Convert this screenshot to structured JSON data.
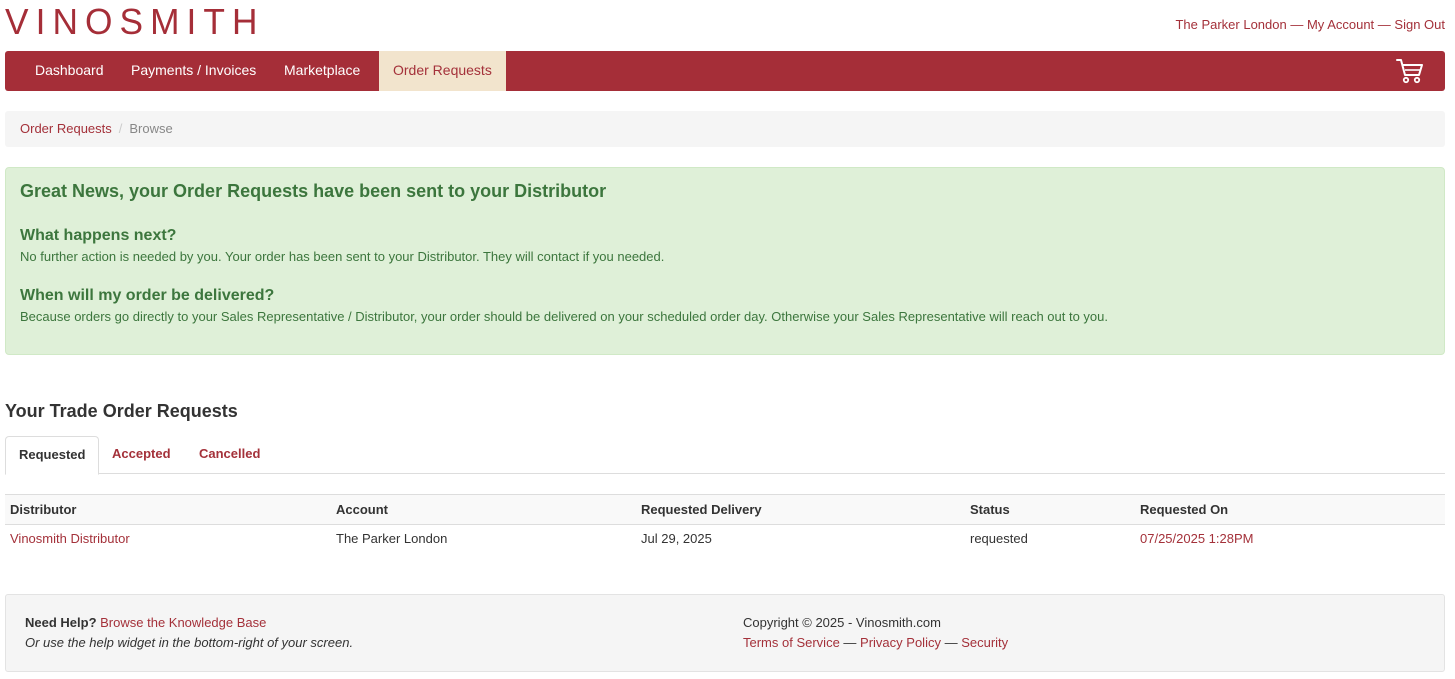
{
  "brand": {
    "logo": "VINOSMITH"
  },
  "top_links": {
    "account_name": "The Parker London",
    "sep1": " — ",
    "my_account": "My Account",
    "sep2": " — ",
    "sign_out": "Sign Out"
  },
  "nav": {
    "items": [
      {
        "label": "Dashboard"
      },
      {
        "label": "Payments / Invoices"
      },
      {
        "label": "Marketplace"
      },
      {
        "label": "Order Requests"
      }
    ],
    "cart_icon": "shopping-cart"
  },
  "breadcrumb": {
    "parent": "Order Requests",
    "separator": "/",
    "current": "Browse"
  },
  "alert": {
    "title": "Great News, your Order Requests have been sent to your Distributor",
    "q1": "What happens next?",
    "a1": "No further action is needed by you. Your order has been sent to your Distributor. They will contact if you needed.",
    "q2": "When will my order be delivered?",
    "a2": "Because orders go directly to your Sales Representative / Distributor, your order should be delivered on your scheduled order day. Otherwise your Sales Representative will reach out to you."
  },
  "section_title": "Your Trade Order Requests",
  "tabs": [
    {
      "label": "Requested",
      "active": true
    },
    {
      "label": "Accepted",
      "active": false
    },
    {
      "label": "Cancelled",
      "active": false
    }
  ],
  "table": {
    "headers": [
      "Distributor",
      "Account",
      "Requested Delivery",
      "Status",
      "Requested On"
    ],
    "rows": [
      [
        "Vinosmith Distributor",
        "The Parker London",
        "Jul 29, 2025",
        "requested",
        "07/25/2025 1:28PM"
      ]
    ]
  },
  "footer": {
    "need_help": "Need Help?",
    "kb_link": "Browse the Knowledge Base",
    "widget_note": "Or use the help widget in the bottom-right of your screen.",
    "copyright": "Copyright © 2025 - Vinosmith.com",
    "terms": "Terms of Service",
    "sep1": " — ",
    "privacy": "Privacy Policy",
    "sep2": " — ",
    "security": "Security"
  },
  "colors": {
    "brand": "#a52e38",
    "active_tab_bg": "#f2e4cd",
    "alert_bg": "#dff0d8",
    "alert_text": "#3c763d"
  }
}
